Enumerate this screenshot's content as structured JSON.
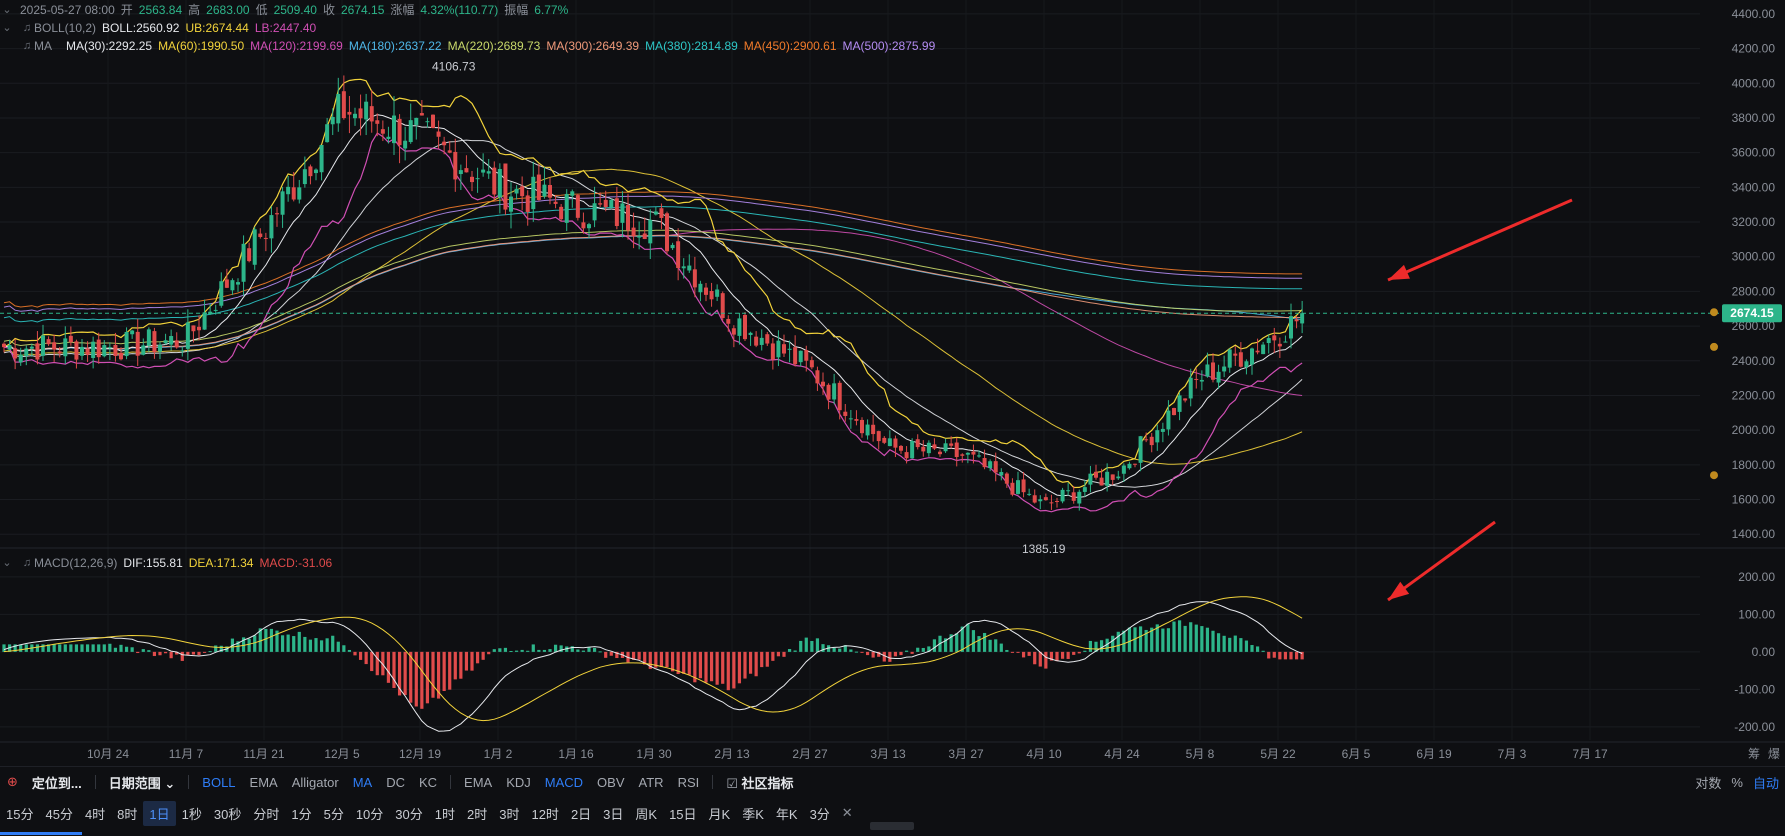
{
  "ohlc_line": {
    "date": "2025-05-27 08:00",
    "open_label": "开",
    "open": "2563.84",
    "high_label": "高",
    "high": "2683.00",
    "low_label": "低",
    "low": "2509.40",
    "close_label": "收",
    "close": "2674.15",
    "change_label": "涨幅",
    "change": "4.32%(110.77)",
    "amp_label": "振幅",
    "amp": "6.77%"
  },
  "boll_line": {
    "name": "BOLL(10,2)",
    "boll": "BOLL:2560.92",
    "ub": "UB:2674.44",
    "lb": "LB:2447.40"
  },
  "ma_line": {
    "name": "MA",
    "items": [
      {
        "text": "MA(30):2292.25",
        "color": "#e6e8ec"
      },
      {
        "text": "MA(60):1990.50",
        "color": "#f2d33b"
      },
      {
        "text": "MA(120):2199.69",
        "color": "#d04fb4"
      },
      {
        "text": "MA(180):2637.22",
        "color": "#4fb7e8"
      },
      {
        "text": "MA(220):2689.73",
        "color": "#c8d86a"
      },
      {
        "text": "MA(300):2649.39",
        "color": "#f09a7a"
      },
      {
        "text": "MA(380):2814.89",
        "color": "#2ec6c6"
      },
      {
        "text": "MA(450):2900.61",
        "color": "#f07a2a"
      },
      {
        "text": "MA(500):2875.99",
        "color": "#b48cf2"
      }
    ]
  },
  "macd_line": {
    "name": "MACD(12,26,9)",
    "dif": "DIF:155.81",
    "dea": "DEA:171.34",
    "macd": "MACD:-31.06"
  },
  "price_tag": "2674.15",
  "toolbar": {
    "locate": "定位到...",
    "date_range": "日期范围",
    "indicators": [
      "BOLL",
      "EMA",
      "Alligator",
      "MA",
      "DC",
      "KC",
      "EMA",
      "KDJ",
      "MACD",
      "OBV",
      "ATR",
      "RSI"
    ],
    "community": "社区指标",
    "right": [
      "对数",
      "%",
      "自动"
    ]
  },
  "intervals": [
    "15分",
    "45分",
    "4时",
    "8时",
    "1日",
    "1秒",
    "30秒",
    "分时",
    "1分",
    "5分",
    "10分",
    "30分",
    "1时",
    "2时",
    "3时",
    "12时",
    "2日",
    "3日",
    "周K",
    "15日",
    "月K",
    "季K",
    "年K",
    "3分"
  ],
  "active_interval": "1日",
  "axis_corner": [
    "筹",
    "爆"
  ],
  "colors": {
    "up": "#2db58a",
    "down": "#e04b4b",
    "boll_mid": "#e6e8ec",
    "boll_ub": "#f2d33b",
    "boll_lb": "#d04fb4",
    "dif": "#e6e8ec",
    "dea": "#f2d33b",
    "arrow": "#ee2b2b"
  },
  "chart_data": [
    {
      "type": "candlestick",
      "title": "",
      "y_ticks": [
        1400,
        1600,
        1800,
        2000,
        2200,
        2400,
        2600,
        2800,
        3000,
        3200,
        3400,
        3600,
        3800,
        4000,
        4200,
        4400
      ],
      "y_tick_format": "2 decimals",
      "ylim": [
        1280,
        4480
      ],
      "x_ticks": [
        "10月 24",
        "11月 7",
        "11月 21",
        "12月 5",
        "12月 19",
        "1月 2",
        "1月 16",
        "1月 30",
        "2月 13",
        "2月 27",
        "3月 13",
        "3月 27",
        "4月 10",
        "4月 24",
        "5月 8",
        "5月 22",
        "6月 5",
        "6月 19",
        "7月 3",
        "7月 17"
      ],
      "annotations": [
        {
          "text": "4106.73",
          "x": "12月 19",
          "y": 4106.73
        },
        {
          "text": "1385.19",
          "x": "4月 10",
          "y": 1385.19
        }
      ],
      "last_price": 2674.15,
      "series_anchor": [
        {
          "x": "10月 24",
          "close": 2480
        },
        {
          "x": "11月 7",
          "close": 2520
        },
        {
          "x": "11月 21",
          "close": 3150
        },
        {
          "x": "12月 5",
          "close": 3850
        },
        {
          "x": "12月 19",
          "close": 3700
        },
        {
          "x": "1月 2",
          "close": 3400
        },
        {
          "x": "1月 16",
          "close": 3280
        },
        {
          "x": "1月 30",
          "close": 3200
        },
        {
          "x": "2月 13",
          "close": 2650
        },
        {
          "x": "2月 27",
          "close": 2350
        },
        {
          "x": "3月 13",
          "close": 1900
        },
        {
          "x": "3月 27",
          "close": 1850
        },
        {
          "x": "4月 10",
          "close": 1560
        },
        {
          "x": "4月 24",
          "close": 1780
        },
        {
          "x": "5月 8",
          "close": 2300
        },
        {
          "x": "5月 22",
          "close": 2560
        },
        {
          "x": "5月 27",
          "close": 2674.15
        }
      ],
      "moving_averages": [
        {
          "name": "MA(30)",
          "last": 2292.25
        },
        {
          "name": "MA(60)",
          "last": 1990.5
        },
        {
          "name": "MA(120)",
          "last": 2199.69
        },
        {
          "name": "MA(180)",
          "last": 2637.22
        },
        {
          "name": "MA(220)",
          "last": 2689.73
        },
        {
          "name": "MA(300)",
          "last": 2649.39
        },
        {
          "name": "MA(380)",
          "last": 2814.89
        },
        {
          "name": "MA(450)",
          "last": 2900.61
        },
        {
          "name": "MA(500)",
          "last": 2875.99
        }
      ]
    },
    {
      "type": "bar",
      "title": "",
      "y_ticks": [
        -200,
        -100,
        0,
        100,
        200
      ],
      "ylim": [
        -235,
        245
      ],
      "macd_anchor": [
        {
          "x": "10月 24",
          "hist": 20
        },
        {
          "x": "11月 7",
          "hist": -20
        },
        {
          "x": "11月 21",
          "hist": 60
        },
        {
          "x": "12月 5",
          "hist": 30
        },
        {
          "x": "12月 19",
          "hist": -160
        },
        {
          "x": "1月 2",
          "hist": 10
        },
        {
          "x": "1月 16",
          "hist": 15
        },
        {
          "x": "1月 30",
          "hist": -40
        },
        {
          "x": "2月 13",
          "hist": -100
        },
        {
          "x": "2月 27",
          "hist": 40
        },
        {
          "x": "3月 13",
          "hist": -30
        },
        {
          "x": "3月 27",
          "hist": 70
        },
        {
          "x": "4月 10",
          "hist": -40
        },
        {
          "x": "4月 24",
          "hist": 60
        },
        {
          "x": "5月 8",
          "hist": 80
        },
        {
          "x": "5月 22",
          "hist": -20
        }
      ]
    }
  ]
}
